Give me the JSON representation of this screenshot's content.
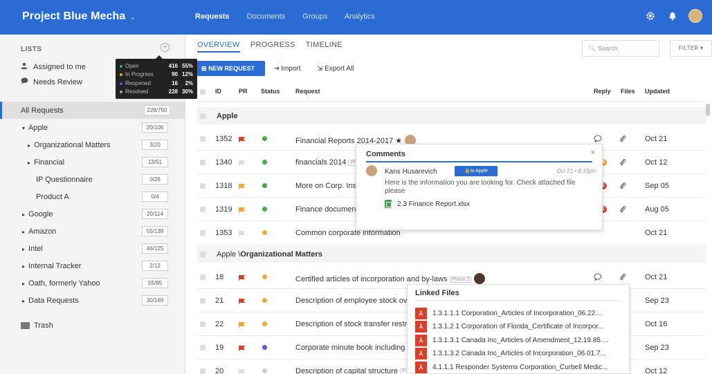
{
  "header": {
    "project_title": "Project Blue Mecha",
    "tabs": [
      {
        "label": "Requests",
        "active": true
      },
      {
        "label": "Documents",
        "active": false
      },
      {
        "label": "Groups",
        "active": false
      },
      {
        "label": "Analytics",
        "active": false
      }
    ],
    "colors": {
      "topbar": "#2b6cd4"
    }
  },
  "sidebar": {
    "lists_label": "LISTS",
    "assigned_label": "Assigned to me",
    "review_label": "Needs Review",
    "trash_label": "Trash",
    "tooltip": [
      {
        "label": "Open",
        "count": "416",
        "pct": "55%",
        "color": "#3fae49"
      },
      {
        "label": "In Progress",
        "count": "90",
        "pct": "12%",
        "color": "#f2a73b"
      },
      {
        "label": "Reopened",
        "count": "16",
        "pct": "2%",
        "color": "#6a4fd8"
      },
      {
        "label": "Resolved",
        "count": "228",
        "pct": "30%",
        "color": "#aaaaaa"
      }
    ],
    "tree": [
      {
        "label": "All Requests",
        "badge": "228/750",
        "indent": 0,
        "caret": "",
        "selected": true
      },
      {
        "label": "Apple",
        "badge": "20/106",
        "indent": 1,
        "caret": "▾",
        "selected": false
      },
      {
        "label": "Organizational Matters",
        "badge": "3/20",
        "indent": 2,
        "caret": "▸",
        "selected": false
      },
      {
        "label": "Financial",
        "badge": "13/51",
        "indent": 2,
        "caret": "▸",
        "selected": false
      },
      {
        "label": "IP Questionnaire",
        "badge": "0/26",
        "indent": 3,
        "caret": "",
        "selected": false
      },
      {
        "label": "Product A",
        "badge": "0/4",
        "indent": 3,
        "caret": "",
        "selected": false
      },
      {
        "label": "Google",
        "badge": "20/114",
        "indent": 1,
        "caret": "▸",
        "selected": false
      },
      {
        "label": "Amazon",
        "badge": "55/139",
        "indent": 1,
        "caret": "▸",
        "selected": false
      },
      {
        "label": "Intel",
        "badge": "46/125",
        "indent": 1,
        "caret": "▸",
        "selected": false
      },
      {
        "label": "Internal Tracker",
        "badge": "2/12",
        "indent": 1,
        "caret": "▸",
        "selected": false
      },
      {
        "label": "Oath, formerly Yahoo",
        "badge": "55/85",
        "indent": 1,
        "caret": "▸",
        "selected": false
      },
      {
        "label": "Data Requests",
        "badge": "30/169",
        "indent": 1,
        "caret": "▸",
        "selected": false
      }
    ]
  },
  "main": {
    "subtabs": [
      {
        "label": "OVERVIEW",
        "active": true
      },
      {
        "label": "PROGRESS",
        "active": false
      },
      {
        "label": "TIMELINE",
        "active": false
      }
    ],
    "search_placeholder": "Search",
    "filter_label": "FILTER ▾",
    "new_request_label": "NEW REQUEST",
    "import_label": "Import",
    "export_label": "Export All",
    "columns": {
      "id": "ID",
      "pr": "PR",
      "status": "Status",
      "request": "Request",
      "reply": "Reply",
      "files": "Files",
      "updated": "Updated"
    },
    "group_apple": "Apple",
    "group_org_prefix": "Apple \\",
    "group_org_name": "Organizational Matters",
    "rows": [
      {
        "id": "1352",
        "flag": "#d9402b",
        "status": "#3fae49",
        "request": "Financial Reports 2014-2017 ★",
        "phase": "",
        "updated": "Oct 21"
      },
      {
        "id": "1340",
        "flag": "#dddddd",
        "status": "#3fae49",
        "request": "financials 2014",
        "phase": "Ph",
        "updated": "Oct 12"
      },
      {
        "id": "1318",
        "flag": "#f2a73b",
        "status": "#3fae49",
        "request": "More on Corp. Ins",
        "phase": "",
        "updated": "Sep 05"
      },
      {
        "id": "1319",
        "flag": "#f2a73b",
        "status": "#3fae49",
        "request": "Finance documen",
        "phase": "",
        "updated": "Aug 05"
      },
      {
        "id": "1353",
        "flag": "#dddddd",
        "status": "#f2a73b",
        "request": "Common corporate information",
        "phase": "",
        "updated": "Oct 21"
      }
    ],
    "rows2": [
      {
        "id": "18",
        "flag": "#d9402b",
        "status": "#f2a73b",
        "request": "Certified articles of incorporation and by-laws",
        "phase": "Phase 2",
        "updated": "Oct 21"
      },
      {
        "id": "21",
        "flag": "#d9402b",
        "status": "#f2a73b",
        "request": "Description of employee stock ov",
        "phase": "",
        "updated": "Sep 23"
      },
      {
        "id": "22",
        "flag": "#f2a73b",
        "status": "#f2a73b",
        "request": "Description of stock transfer restr",
        "phase": "",
        "updated": "Oct 16"
      },
      {
        "id": "19",
        "flag": "#d9402b",
        "status": "#6a4fd8",
        "request": "Corporate minute book including",
        "phase": "",
        "updated": "Sep 23"
      },
      {
        "id": "20",
        "flag": "#dddddd",
        "status": "#cccccc",
        "request": "Description of capital structure",
        "phase": "P",
        "updated": "Oct 12"
      }
    ],
    "reply_counts": {
      "r1340": "1",
      "r1318": "1",
      "r1319": "1"
    }
  },
  "comments_popup": {
    "title": "Comments",
    "close": "×",
    "author": "Kans Husarevich",
    "tag": "🔒to Apple",
    "time": "Oct 21 • 8:33pm",
    "body": "Here is the information you are looking for. Check attached file please",
    "file": "2.3 Finance Report.xlsx"
  },
  "linked_popup": {
    "title": "Linked Files",
    "files": [
      "1.3.1.1.1 Corporation_Articles of Incorporation_06.22....",
      "1.3.1.2.1 Corporation of Florida_Certificate of Incorpor...",
      "1.3.1.3.1 Canada Inc_Articles of Amendment_12.19.85....",
      "1.3.1.3.2 Canada Inc_Articles of Incorporation_06.01.7...",
      "4.1.1.1 Responder Systems Corporation_Curbell Medic..."
    ]
  }
}
